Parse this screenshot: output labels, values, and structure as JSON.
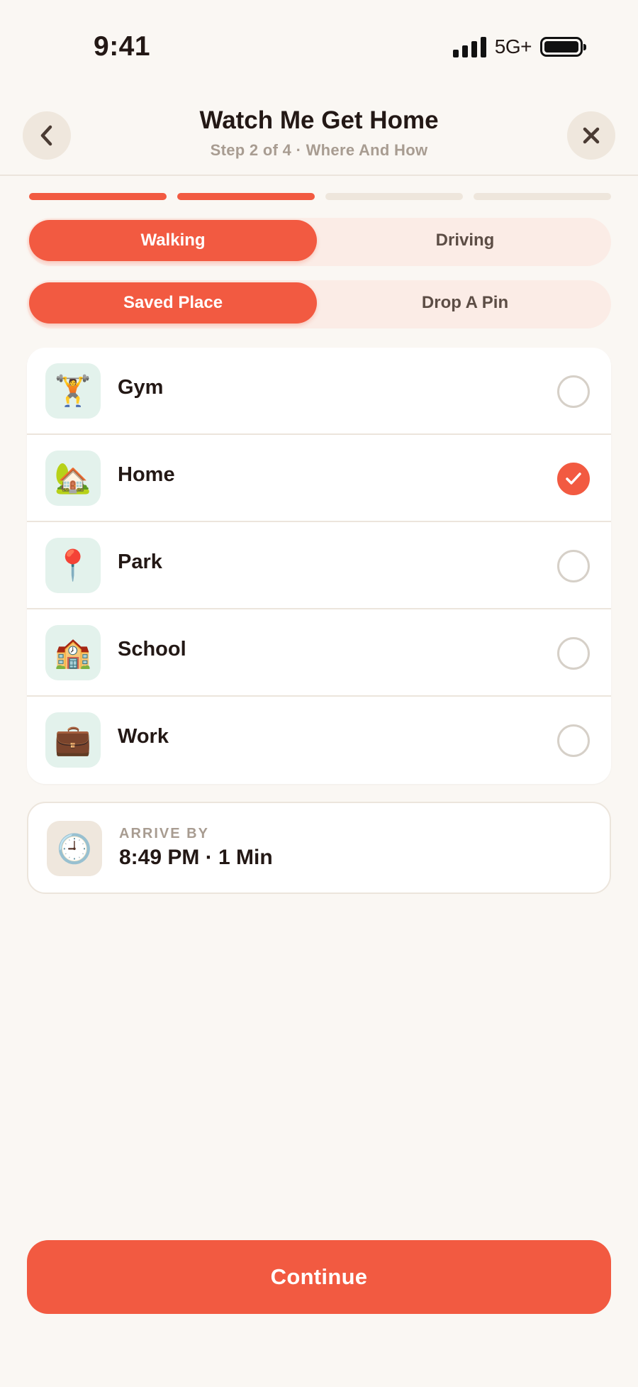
{
  "status_bar": {
    "time": "9:41",
    "network": "5G+"
  },
  "header": {
    "title": "Watch Me Get Home",
    "subtitle": "Step 2 of 4 · Where And How",
    "back_icon": "chevron-left-icon",
    "close_icon": "close-icon"
  },
  "progress": {
    "current_step": 2,
    "total_steps": 4
  },
  "travel_mode": {
    "options": [
      "Walking",
      "Driving"
    ],
    "selected": "Walking"
  },
  "destination_source": {
    "options": [
      "Saved Place",
      "Drop A Pin"
    ],
    "selected": "Saved Place"
  },
  "places": [
    {
      "label": "Gym",
      "icon": "🏋️",
      "icon_name": "weightlifter-icon",
      "selected": false
    },
    {
      "label": "Home",
      "icon": "🏡",
      "icon_name": "house-garden-icon",
      "selected": true
    },
    {
      "label": "Park",
      "icon": "📍",
      "icon_name": "pushpin-icon",
      "selected": false
    },
    {
      "label": "School",
      "icon": "🏫",
      "icon_name": "school-building-icon",
      "selected": false
    },
    {
      "label": "Work",
      "icon": "💼",
      "icon_name": "briefcase-icon",
      "selected": false
    }
  ],
  "arrive": {
    "label": "ARRIVE BY",
    "value": "8:49 PM · 1 Min",
    "icon": "🕘",
    "icon_name": "clock-icon"
  },
  "continue_label": "Continue",
  "colors": {
    "accent": "#f25a41",
    "background": "#faf7f3",
    "muted_text": "#a89c91"
  }
}
